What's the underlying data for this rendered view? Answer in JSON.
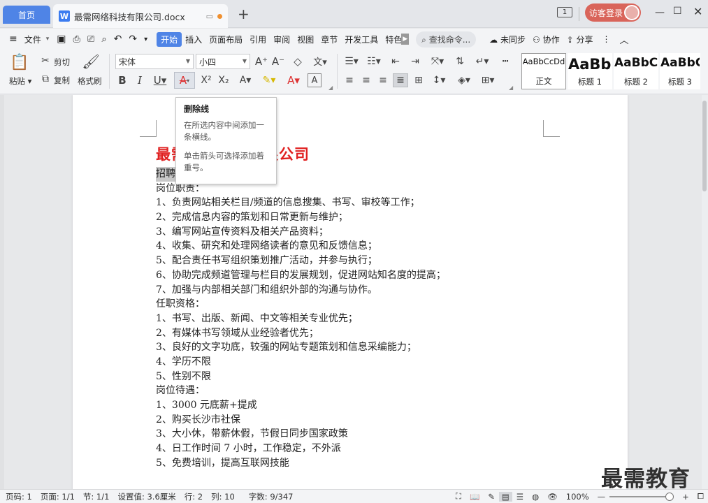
{
  "titlebar": {
    "home_tab": "首页",
    "doc_tab": "最需网络科技有限公司.docx",
    "new_tab": "+",
    "window_count": "1",
    "login": "访客登录"
  },
  "menubar": {
    "items": [
      {
        "label": "文件",
        "active": false
      },
      {
        "label": "开始",
        "active": true
      },
      {
        "label": "插入",
        "active": false
      },
      {
        "label": "页面布局",
        "active": false
      },
      {
        "label": "引用",
        "active": false
      },
      {
        "label": "审阅",
        "active": false
      },
      {
        "label": "视图",
        "active": false
      },
      {
        "label": "章节",
        "active": false
      },
      {
        "label": "开发工具",
        "active": false
      },
      {
        "label": "特色",
        "active": false
      }
    ],
    "search": "查找命令...",
    "sync": "未同步",
    "collab": "协作",
    "share": "分享"
  },
  "ribbon": {
    "paste": "粘贴",
    "cut": "剪切",
    "copy": "复制",
    "format_painter": "格式刷",
    "font_name": "宋体",
    "font_size": "小四",
    "styles": [
      {
        "sample": "AaBbCcDd",
        "name": "正文"
      },
      {
        "sample": "AaBb",
        "name": "标题 1"
      },
      {
        "sample": "AaBbC",
        "name": "标题 2"
      },
      {
        "sample": "AaBbC",
        "name": "标题 3"
      }
    ]
  },
  "tooltip": {
    "title": "删除线",
    "line1": "在所选内容中间添加一条横线。",
    "line2": "单击箭头可选择添加着重号。"
  },
  "document": {
    "title": "最需网络科技有限公司",
    "lines": [
      "招聘岗位：网站编辑",
      "岗位职责：",
      "1、负责网站相关栏目/频道的信息搜集、书写、审校等工作；",
      "2、完成信息内容的策划和日常更新与维护；",
      "3、编写网站宣传资料及相关产品资料；",
      "4、收集、研究和处理网络读者的意见和反馈信息；",
      "5、配合责任书写组织策划推广活动，并参与执行；",
      "6、协助完成频道管理与栏目的发展规划，促进网站知名度的提高；",
      "7、加强与内部相关部门和组织外部的沟通与协作。",
      "任职资格：",
      "1、书写、出版、新闻、中文等相关专业优先；",
      "2、有媒体书写领域从业经验者优先；",
      "3、良好的文字功底，较强的网站专题策划和信息采编能力；",
      "4、学历不限",
      "5、性别不限",
      "岗位待遇：",
      "1、3000 元底薪+提成",
      "2、购买长沙市社保",
      "3、大小休，带薪休假，节假日同步国家政策",
      "4、日工作时间 7 小时，工作稳定，不外派",
      "5、免费培训，提高互联网技能"
    ]
  },
  "statusbar": {
    "page_no": "页码: 1",
    "page_count": "页面: 1/1",
    "section": "节: 1/1",
    "setting": "设置值: 3.6厘米",
    "row": "行: 2",
    "col": "列: 10",
    "words": "字数: 9/347",
    "zoom": "100%"
  },
  "watermark": "最需教育",
  "colors": {
    "accent": "#4f84e6",
    "title_red": "#e02020",
    "login": "#d9645a"
  }
}
